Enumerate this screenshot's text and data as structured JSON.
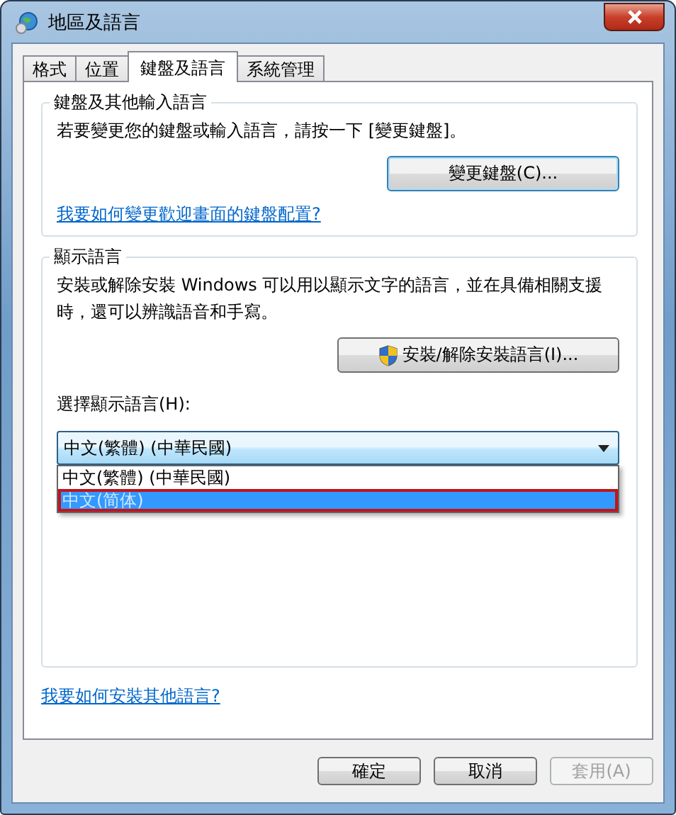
{
  "window": {
    "title": "地區及語言"
  },
  "tabs": [
    {
      "label": "格式",
      "selected": false
    },
    {
      "label": "位置",
      "selected": false
    },
    {
      "label": "鍵盤及語言",
      "selected": true
    },
    {
      "label": "系統管理",
      "selected": false
    }
  ],
  "keyboard_group": {
    "title": "鍵盤及其他輸入語言",
    "text": "若要變更您的鍵盤或輸入語言，請按一下 [變更鍵盤]。",
    "button": "變更鍵盤(C)...",
    "link": "我要如何變更歡迎畫面的鍵盤配置?"
  },
  "display_group": {
    "title": "顯示語言",
    "text": "安裝或解除安裝 Windows 可以用以顯示文字的語言，並在具備相關支援時，還可以辨識語音和手寫。",
    "button": "安裝/解除安裝語言(I)...",
    "select_label": "選擇顯示語言(H):",
    "dropdown": {
      "value": "中文(繁體) (中華民國)",
      "expanded": true,
      "options": [
        {
          "label": "中文(繁體) (中華民國)",
          "highlighted": false
        },
        {
          "label": "中文(简体)",
          "highlighted": true
        }
      ]
    }
  },
  "link": "我要如何安裝其他語言?",
  "buttons": [
    {
      "label": "確定",
      "disabled": false
    },
    {
      "label": "取消",
      "disabled": false
    },
    {
      "label": "套用(A)",
      "disabled": true
    }
  ]
}
